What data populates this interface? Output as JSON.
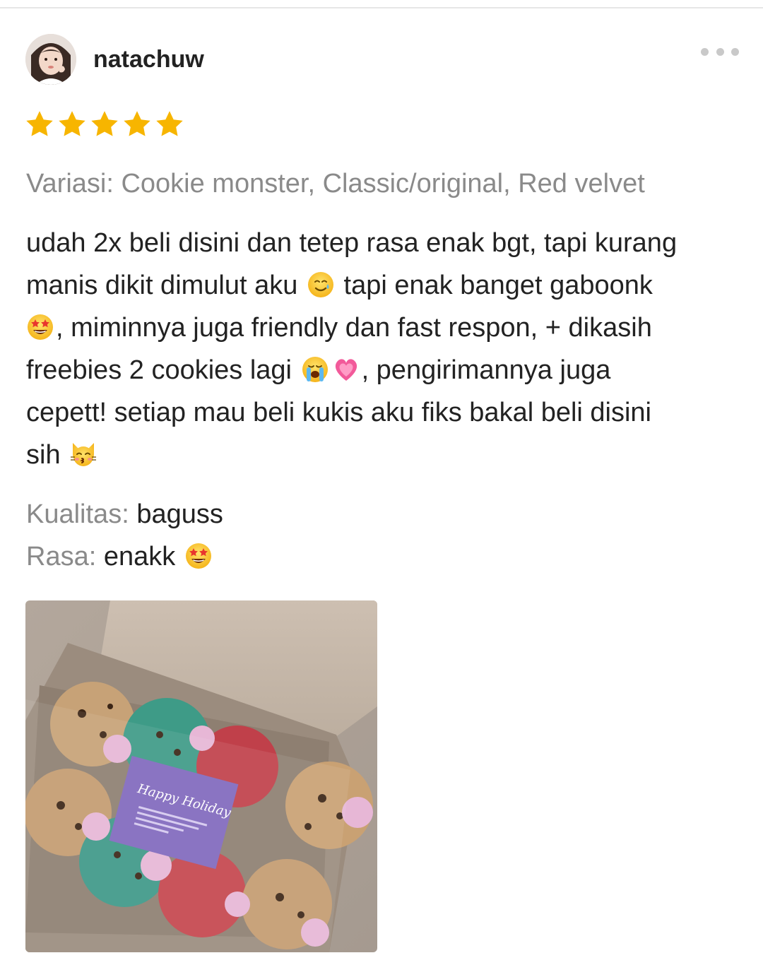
{
  "review": {
    "username": "natachuw",
    "rating": 5,
    "rating_max": 5,
    "variation": "Variasi: Cookie monster, Classic/original, Red velvet",
    "body": {
      "line1": "udah 2x beli disini dan tetep rasa enak bgt, tapi kurang",
      "line2_a": "manis dikit dimulut aku",
      "line2_b": "tapi enak banget gaboonk",
      "line3": ", miminnya juga friendly dan fast respon, + dikasih",
      "line4_a": "freebies 2 cookies lagi",
      "line4_b": ", pengirimannya juga",
      "line5": "cepett! setiap mau beli kukis aku fiks bakal beli disini",
      "line6": "sih"
    },
    "attributes": {
      "quality_label": "Kualitas:",
      "quality_value": "baguss",
      "taste_label": "Rasa:",
      "taste_value": "enakk"
    },
    "photo": {
      "card_text": "Happy Holiday"
    }
  },
  "icons": {
    "star": "star-icon",
    "more": "more-options-icon",
    "emoji_1": "smiling-face-with-tear-emoji",
    "emoji_2": "star-struck-emoji",
    "emoji_3": "loudly-crying-face-emoji",
    "emoji_4": "growing-heart-emoji",
    "emoji_5": "kissing-cat-emoji"
  },
  "colors": {
    "star": "#F7B500",
    "muted_text": "#8A8A8A",
    "primary_text": "#222222"
  }
}
